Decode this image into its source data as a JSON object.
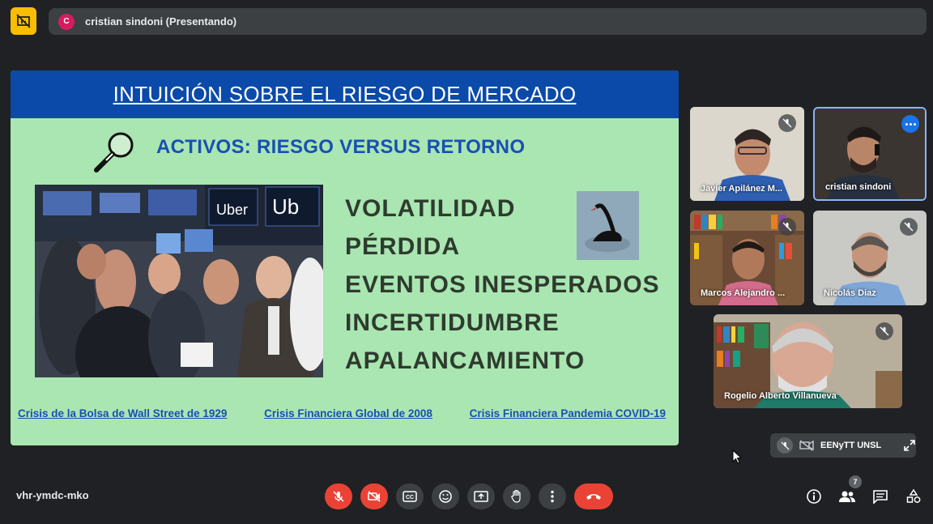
{
  "topbar": {
    "presenter_initial": "C",
    "presenter_text": "cristian sindoni (Presentando)"
  },
  "slide": {
    "title": "INTUICIÓN SOBRE EL RIESGO DE MERCADO",
    "subtitle": "ACTIVOS: RIESGO VERSUS RETORNO",
    "photo_signs": [
      "Uber",
      "Ub"
    ],
    "keywords": [
      "VOLATILIDAD",
      "PÉRDIDA",
      "EVENTOS INESPERADOS",
      "INCERTIDUMBRE",
      "APALANCAMIENTO"
    ],
    "links": [
      "Crisis de la Bolsa de Wall Street de 1929",
      "Crisis Financiera Global de 2008",
      "Crisis Financiera Pandemia COVID-19"
    ]
  },
  "participants": [
    {
      "name": "Javier Apilánez M...",
      "muted": true
    },
    {
      "name": "cristian sindoni",
      "muted": false,
      "active": true
    },
    {
      "name": "Marcos Alejandro ...",
      "muted": true
    },
    {
      "name": "Nicolás Diaz",
      "muted": true
    },
    {
      "name": "Rogelio Alberto Villanueva",
      "muted": true
    }
  ],
  "self_view": {
    "name": "EENyTT UNSL"
  },
  "bottom": {
    "meeting_code": "vhr-ymdc-mko",
    "participant_count": "7"
  },
  "colors": {
    "background": "#202124",
    "slide_bg": "#a9e6b1",
    "slide_header": "#0b4aa8",
    "link": "#1a4fb5",
    "danger": "#ea4335",
    "present_icon": "#fbbc04",
    "active_tile_border": "#8ab4f8"
  }
}
